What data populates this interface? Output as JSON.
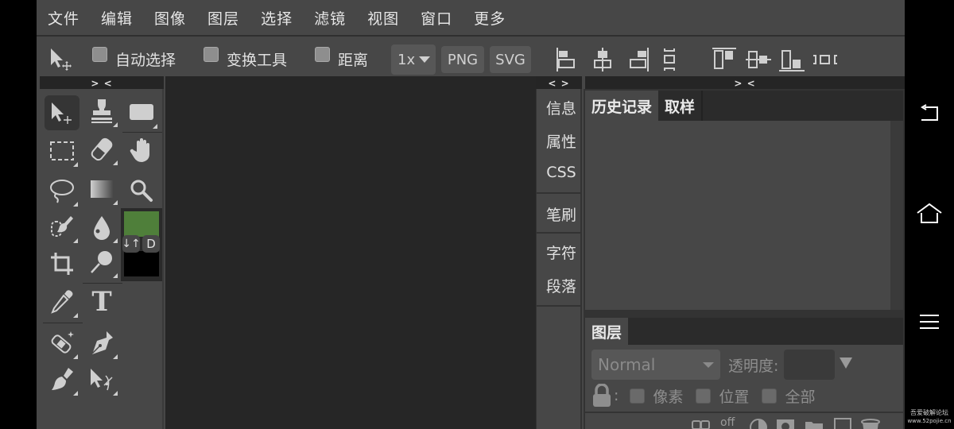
{
  "menu": {
    "items": [
      "文件",
      "编辑",
      "图像",
      "图层",
      "选择",
      "滤镜",
      "视图",
      "窗口",
      "更多"
    ]
  },
  "toolbar": {
    "move_tool_icon": "move-tool-icon",
    "auto_select_label": "自动选择",
    "auto_select_checked": false,
    "transform_tool_label": "变换工具",
    "transform_tool_checked": false,
    "distance_label": "距离",
    "distance_checked": false,
    "scale_label": "1x",
    "png_label": "PNG",
    "svg_label": "SVG",
    "align_icons": [
      "align-left-icon",
      "align-center-horizontal-icon",
      "align-right-icon",
      "distribute-vertical-icon",
      "align-top-icon",
      "align-center-vertical-icon",
      "align-bottom-icon",
      "distribute-horizontal-icon"
    ]
  },
  "collapse": {
    "toolbox_toggle": "> <",
    "side_toggle": "< >",
    "panel_toggle": "> <"
  },
  "toolbox": {
    "tools": [
      "move-select",
      "clone-stamp",
      "rectangle-shape",
      "rect-select",
      "eraser",
      "hand",
      "lasso",
      "gradient",
      "zoom",
      "quick-select",
      "blur",
      "crop",
      "dodge",
      "eyedropper",
      "text",
      "healing",
      "pen",
      "brush",
      "path-select"
    ],
    "foreground_color": "#4f7f3a",
    "background_color": "#000000",
    "swap_label": "↓↑",
    "default_label": "D"
  },
  "side_tabs": {
    "group1": [
      "信息",
      "属性",
      "CSS"
    ],
    "group2": [
      "笔刷"
    ],
    "group3": [
      "字符",
      "段落"
    ]
  },
  "right_panel": {
    "tabs": [
      {
        "label": "历史记录",
        "active": true
      },
      {
        "label": "取样",
        "active": false
      }
    ],
    "layers_tab": "图层",
    "blend_mode": "Normal",
    "opacity_label": "透明度:",
    "opacity_value": "",
    "lock_label": ":",
    "lock_options": [
      {
        "label": "像素",
        "checked": false
      },
      {
        "label": "位置",
        "checked": false
      },
      {
        "label": "全部",
        "checked": false
      }
    ],
    "layer_actions": [
      "link-icon",
      "fx-off",
      "adjustment-icon",
      "mask-icon",
      "folder-icon",
      "new-layer-icon",
      "trash-icon"
    ],
    "fx_label": "off"
  },
  "nav": {
    "back": "back-icon",
    "home": "home-icon",
    "menu": "menu-icon"
  },
  "watermark": {
    "line1": "吾爱破解论坛",
    "line2": "www.52pojie.cn"
  }
}
